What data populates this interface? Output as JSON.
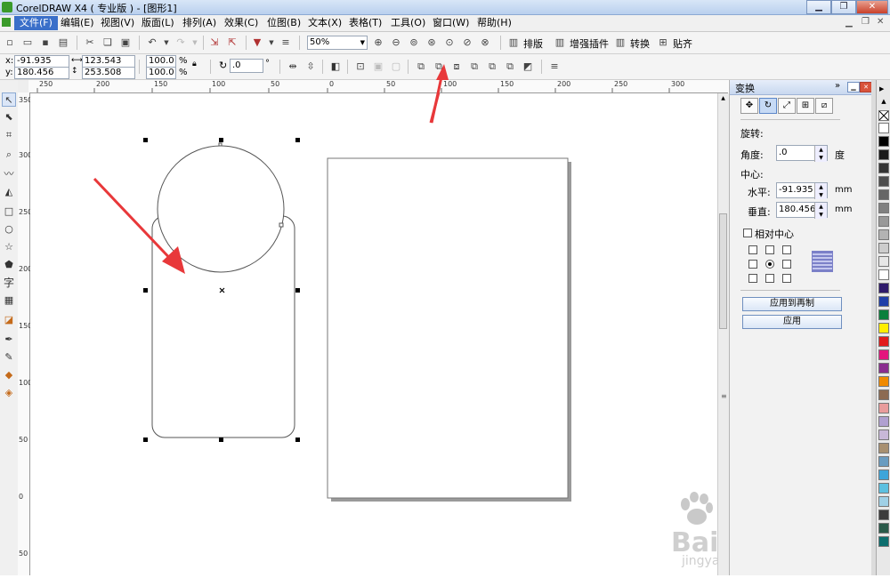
{
  "window": {
    "title": "CorelDRAW X4 ( 专业版 ) - [图形1]"
  },
  "menu": [
    "文件(F)",
    "编辑(E)",
    "视图(V)",
    "版面(L)",
    "排列(A)",
    "效果(C)",
    "位图(B)",
    "文本(X)",
    "表格(T)",
    "工具(O)",
    "窗口(W)",
    "帮助(H)"
  ],
  "toolbar": {
    "zoom": "50%",
    "layout": "排版",
    "plugins": "增强插件",
    "convert": "转换",
    "snap": "贴齐"
  },
  "property_bar": {
    "x_label": "x:",
    "y_label": "y:",
    "x_value": "-91.935 mm",
    "y_value": "180.456 mm",
    "width": "123.543 mm",
    "height": "253.508 mm",
    "scale_w": "100.0",
    "scale_h": "100.0",
    "pct": "%",
    "rotation": ".0",
    "degree": "°"
  },
  "ruler": {
    "h_ticks": [
      "250",
      "200",
      "150",
      "100",
      "50",
      "0",
      "50",
      "100",
      "150",
      "200",
      "250",
      "300"
    ],
    "v_ticks": [
      "350",
      "300",
      "250",
      "200",
      "150",
      "100",
      "50",
      "0",
      "50"
    ]
  },
  "docker": {
    "title": "变换",
    "section": "旋转:",
    "angle_label": "角度:",
    "angle_value": ".0",
    "angle_unit": "度",
    "center_label": "中心:",
    "h_label": "水平:",
    "h_value": "-91.935",
    "h_unit": "mm",
    "v_label": "垂直:",
    "v_value": "180.456",
    "v_unit": "mm",
    "relative_center": "相对中心",
    "apply_copy": "应用到再制",
    "apply": "应用"
  },
  "watermark": {
    "brand": "Bai du 经验",
    "url": "jingyan.baidu.com"
  },
  "palette_colors": [
    "#ffffff",
    "#000000",
    "#1a1a1a",
    "#333333",
    "#4d4d4d",
    "#666666",
    "#808080",
    "#999999",
    "#b3b3b3",
    "#cccccc",
    "#e6e6e6",
    "#ffffff",
    "#2e1a6b",
    "#1f3fa8",
    "#0a7f3c",
    "#ffee00",
    "#e21b1b",
    "#e4167d",
    "#8a2d8f",
    "#f08a00",
    "#8c6b52",
    "#e89c9c",
    "#b0a0d0",
    "#c8b8d8",
    "#a89070",
    "#6a9cc0",
    "#3da5d9",
    "#5cc0e0",
    "#9fd0e6",
    "#3c3c3c",
    "#2a5a4a",
    "#0d6e6e"
  ]
}
